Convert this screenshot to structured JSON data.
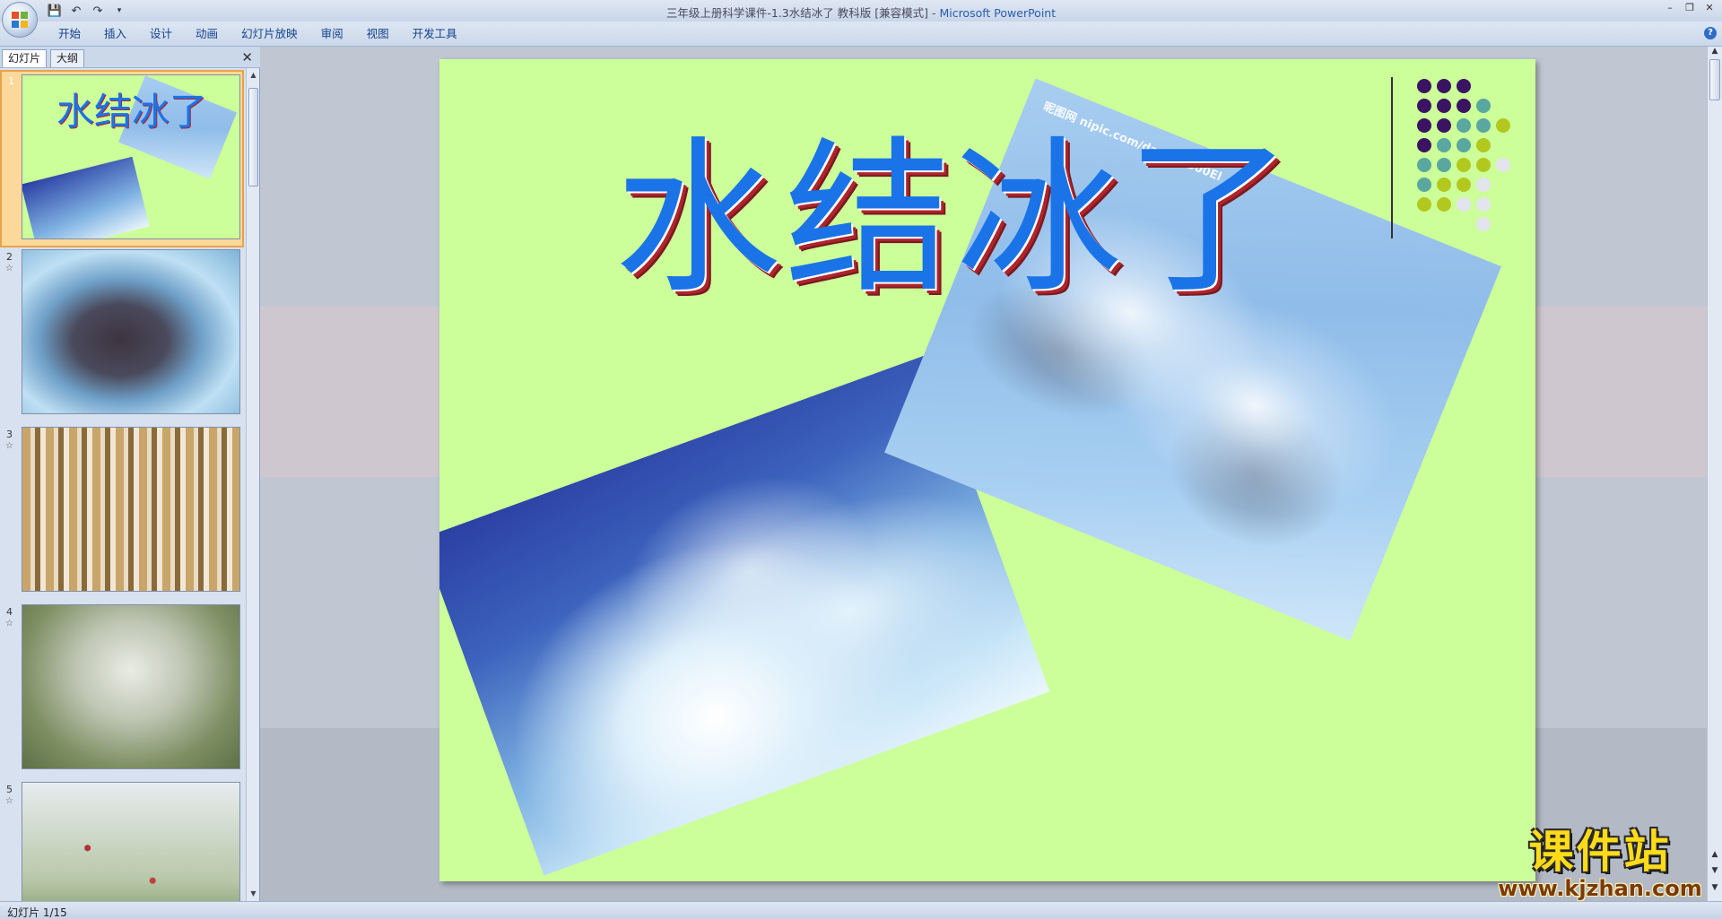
{
  "window": {
    "title": "三年级上册科学课件-1.3水结冰了 教科版 [兼容模式] - ",
    "app_name": "Microsoft PowerPoint"
  },
  "ribbon": {
    "tabs": [
      {
        "label": "开始"
      },
      {
        "label": "插入"
      },
      {
        "label": "设计"
      },
      {
        "label": "动画"
      },
      {
        "label": "幻灯片放映"
      },
      {
        "label": "审阅"
      },
      {
        "label": "视图"
      },
      {
        "label": "开发工具"
      }
    ]
  },
  "left_pane": {
    "tab_slides": "幻灯片",
    "tab_outline": "大纲",
    "thumbnails": [
      {
        "number": "1",
        "active": true
      },
      {
        "number": "2",
        "active": false
      },
      {
        "number": "3",
        "active": false
      },
      {
        "number": "4",
        "active": false
      },
      {
        "number": "5",
        "active": false
      }
    ]
  },
  "slide": {
    "title": "水结冰了",
    "image_watermark": "昵图网 nipic.com/daniel4300El"
  },
  "status_bar": {
    "slide_counter": "幻灯片 1/15"
  },
  "watermark": {
    "chinese": "课件站",
    "url": "www.kjzhan.com"
  },
  "colors": {
    "slide_background": "#ccff99",
    "title_fill": "#1a74e8",
    "title_shadow": "#b0242c",
    "dot_purple": "#3a1463",
    "dot_teal": "#5aa7a0",
    "dot_lime": "#b3c81e",
    "dot_light": "#e4e4ee"
  }
}
